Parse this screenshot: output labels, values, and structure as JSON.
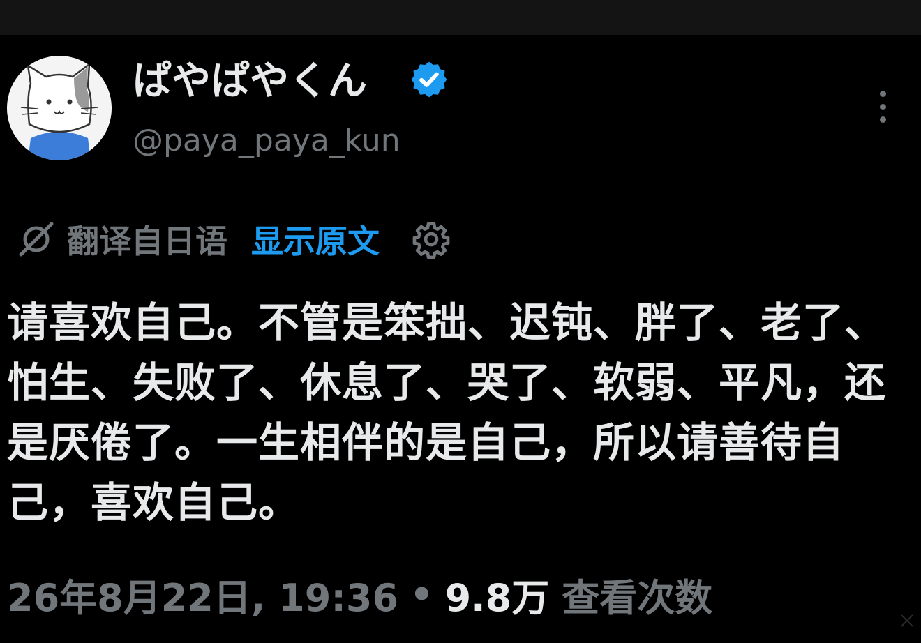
{
  "author": {
    "display_name": "ぱやぱやくん",
    "handle": "@paya_paya_kun",
    "verified": true,
    "avatar_icon": "cat-avatar-icon"
  },
  "translation": {
    "label": "翻译自日语",
    "show_original": "显示原文",
    "icon": "translate-icon",
    "settings_icon": "gear-icon"
  },
  "tweet": {
    "text": "请喜欢自己。不管是笨拙、迟钝、胖了、老了、怕生、失败了、休息了、哭了、软弱、平凡，还是厌倦了。一生相伴的是自己，所以请善待自己，喜欢自己。"
  },
  "meta": {
    "datetime": "26年8月22日, 19:36",
    "separator": "•",
    "views": "9.8万",
    "views_label": "查看次数"
  },
  "colors": {
    "background": "#000000",
    "text": "#e7e9ea",
    "secondary": "#71767b",
    "accent": "#1d9bf0"
  }
}
